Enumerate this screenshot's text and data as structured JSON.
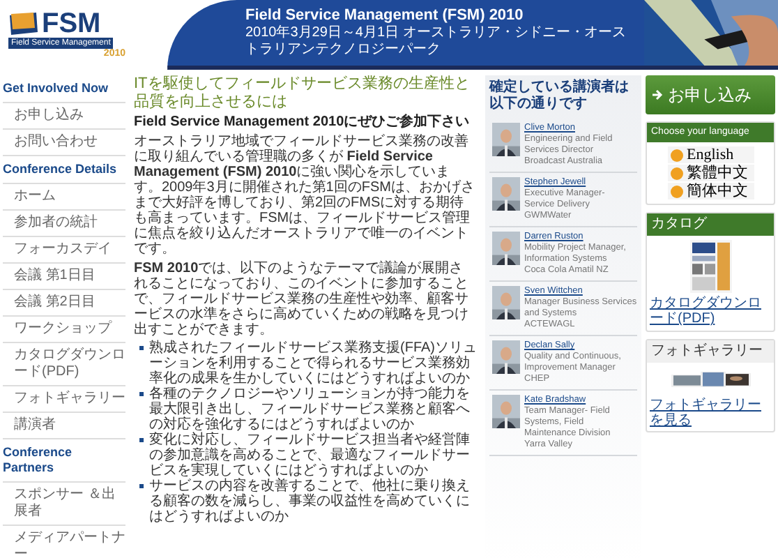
{
  "header": {
    "logo_text": "FSM",
    "logo_tagline": "Field Service Management",
    "logo_year": "2010",
    "title": "Field Service Management (FSM) 2010",
    "subtitle": "2010年3月29日～4月1日 オーストラリア・シドニー・オーストラリアンテクノロジーパーク"
  },
  "nav": [
    {
      "heading": "Get Involved Now",
      "items": [
        {
          "label": "お申し込み"
        },
        {
          "label": "お問い合わせ"
        }
      ]
    },
    {
      "heading": "Conference Details",
      "items": [
        {
          "label": "ホーム"
        },
        {
          "label": "参加者の統計"
        },
        {
          "label": "フォーカスデイ"
        },
        {
          "label": "会議 第1日目"
        },
        {
          "label": "会議 第2日目"
        },
        {
          "label": "ワークショップ"
        },
        {
          "label": "カタログダウンロード(PDF)"
        },
        {
          "label": "フォトギャラリー"
        },
        {
          "label": "講演者"
        }
      ]
    },
    {
      "heading": "Conference Partners",
      "items": [
        {
          "label": "スポンサー ＆出展者"
        },
        {
          "label": "メディアパートナー"
        }
      ]
    }
  ],
  "main": {
    "heading": "ITを駆使してフィールドサービス業務の生産性と品質を向上させるには",
    "subheading": "Field Service Management 2010にぜひご参加下さい",
    "paragraphs": [
      "オーストラリア地域でフィールドサービス業務の改善に取り組んでいる管理職の多くが **Field Service Management (FSM) 2010**に強い関心を示しています。2009年3月に開催された第1回のFSMは、おかげさまで大好評を博しており、第2回のFMSに対する期待も高まっています。FSMは、フィールドサービス管理に焦点を絞り込んだオーストラリアで唯一のイベントです。",
      "**FSM 2010**では、以下のようなテーマで議論が展開されることになっており、このイベントに参加することで、フィールドサービス業務の生産性や効率、顧客サービスの水準をさらに高めていくための戦略を見つけ出すことができます。"
    ],
    "bullets": [
      "熟成されたフィールドサービス業務支援(FFA)ソリューションを利用することで得られるサービス業務効率化の成果を生かしていくにはどうすればよいのか",
      "各種のテクノロジーやソリューションが持つ能力を最大限引き出し、フィールドサービス業務と顧客への対応を強化するにはどうすればよいのか",
      "変化に対応し、フィールドサービス担当者や経営陣の参加意識を高めることで、最適なフィールドサービスを実現していくにはどうすればよいのか",
      "サービスの内容を改善することで、他社に乗り換える顧客の数を減らし、事業の収益性を高めていくにはどうすればよいのか"
    ]
  },
  "speakers": {
    "heading": "確定している講演者は以下の通りです",
    "items": [
      {
        "name": "Clive Morton",
        "details": [
          "Engineering and Field Services Director",
          "Broadcast Australia"
        ]
      },
      {
        "name": "Stephen Jewell",
        "details": [
          "Executive Manager- Service Delivery",
          "GWMWater"
        ]
      },
      {
        "name": "Darren Ruston",
        "details": [
          "Mobility Project Manager, Information Systems",
          "Coca Cola Amatil NZ"
        ]
      },
      {
        "name": "Sven Wittchen",
        "details": [
          "Manager Business Services and Systems",
          "ACTEWAGL"
        ]
      },
      {
        "name": "Declan Sally",
        "details": [
          "Quality and Continuous, Improvement Manager",
          "CHEP"
        ]
      },
      {
        "name": "Kate Bradshaw",
        "details": [
          "Team Manager- Field Systems, Field Maintenance Division",
          "Yarra Valley"
        ]
      }
    ]
  },
  "sidebar": {
    "register_button": "お申し込み",
    "language": {
      "heading": "Choose your language",
      "options": [
        {
          "label": "English"
        },
        {
          "label": "繁體中文"
        },
        {
          "label": "簡体中文"
        }
      ]
    },
    "catalog": {
      "heading": "カタログ",
      "link": "カタログダウンロード(PDF)"
    },
    "gallery": {
      "heading": "フォトギャラリー",
      "link": "フォトギャラリーを見る"
    }
  }
}
